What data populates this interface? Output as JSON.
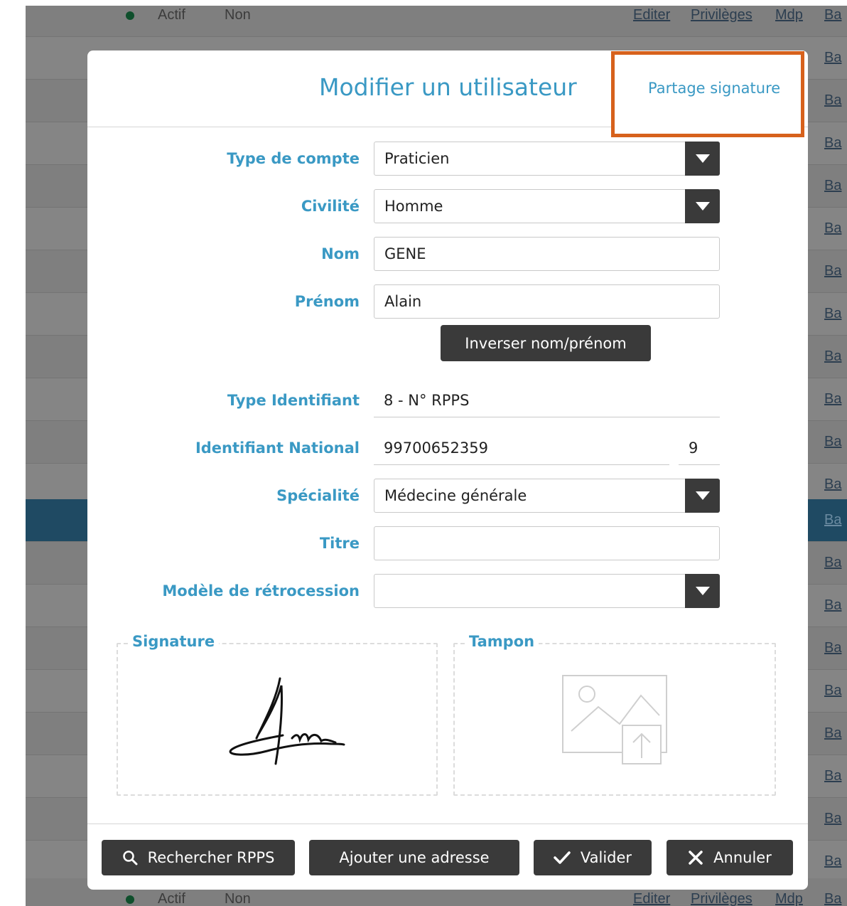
{
  "background": {
    "rows": [
      {
        "status": "Actif",
        "flag": "Non",
        "actions": [
          "Editer",
          "Privilèges",
          "Mdp",
          "Ba"
        ]
      }
    ],
    "row_link": "Ba"
  },
  "modal": {
    "title": "Modifier un utilisateur",
    "partage_link": "Partage signature",
    "fields": {
      "type_compte": {
        "label": "Type de compte",
        "value": "Praticien"
      },
      "civilite": {
        "label": "Civilité",
        "value": "Homme"
      },
      "nom": {
        "label": "Nom",
        "value": "GENE"
      },
      "prenom": {
        "label": "Prénom",
        "value": "Alain"
      },
      "type_identifiant": {
        "label": "Type Identifiant",
        "value": "8 - N° RPPS"
      },
      "identifiant_national": {
        "label": "Identifiant National",
        "value": "99700652359",
        "key": "9"
      },
      "specialite": {
        "label": "Spécialité",
        "value": "Médecine générale"
      },
      "titre": {
        "label": "Titre",
        "value": ""
      },
      "modele_retrocession": {
        "label": "Modèle de rétrocession",
        "value": ""
      }
    },
    "swap_button": "Inverser nom/prénom",
    "signature_legend": "Signature",
    "tampon_legend": "Tampon",
    "footer": {
      "rpps_button": "Rechercher RPPS",
      "adresse_button": "Ajouter une adresse",
      "valider_button": "Valider",
      "annuler_button": "Annuler"
    }
  },
  "colors": {
    "accent": "#3a99c4",
    "highlight_box": "#d7611c",
    "dark_button": "#3a3a3a"
  }
}
